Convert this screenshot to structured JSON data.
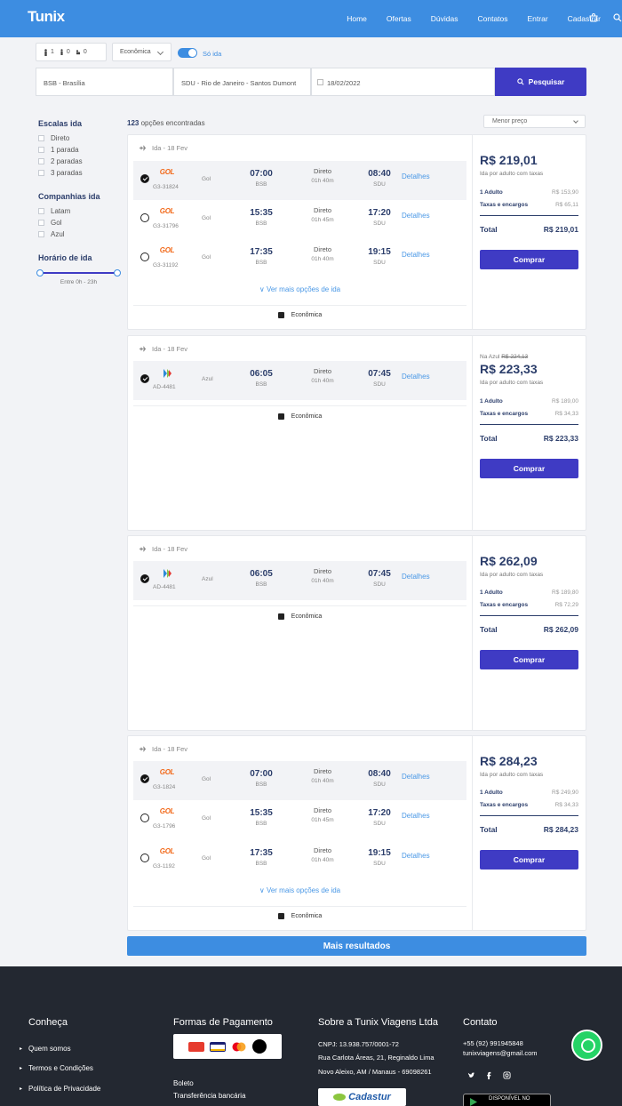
{
  "header": {
    "logo": "Tunix",
    "nav": [
      "Home",
      "Ofertas",
      "Dúvidas",
      "Contatos",
      "Entrar",
      "Cadastrar"
    ]
  },
  "search": {
    "adults": "1",
    "children": "0",
    "infants": "0",
    "cabin": "Econômica",
    "one_way_label": "Só ida",
    "origin": "BSB - Brasília",
    "destination": "SDU - Rio de Janeiro - Santos Dumont",
    "date": "18/02/2022",
    "search_button": "Pesquisar"
  },
  "filters": {
    "stops_title": "Escalas ida",
    "stops": [
      "Direto",
      "1 parada",
      "2 paradas",
      "3 paradas"
    ],
    "airlines_title": "Companhias ida",
    "airlines": [
      "Latam",
      "Gol",
      "Azul"
    ],
    "time_title": "Horário de ida",
    "time_range": "Entre 0h - 23h"
  },
  "results": {
    "count": "123",
    "count_suffix": " opções encontradas",
    "sort": "Menor preço",
    "more_results": "Mais resultados"
  },
  "cards": [
    {
      "header": "Ida - 18 Fev",
      "flights": [
        {
          "airline": "Gol",
          "logo": "GOL",
          "code": "G3-31824",
          "dep": "07:00",
          "dep_apt": "BSB",
          "stops": "Direto",
          "dur": "01h 40m",
          "arr": "08:40",
          "arr_apt": "SDU",
          "details": "Detalhes"
        },
        {
          "airline": "Gol",
          "logo": "GOL",
          "code": "G3-31796",
          "dep": "15:35",
          "dep_apt": "BSB",
          "stops": "Direto",
          "dur": "01h 45m",
          "arr": "17:20",
          "arr_apt": "SDU",
          "details": "Detalhes"
        },
        {
          "airline": "Gol",
          "logo": "GOL",
          "code": "G3-31192",
          "dep": "17:35",
          "dep_apt": "BSB",
          "stops": "Direto",
          "dur": "01h 40m",
          "arr": "19:15",
          "arr_apt": "SDU",
          "details": "Detalhes"
        }
      ],
      "more": "Ver mais opções de ida",
      "cabin": "Econômica",
      "price": "R$ 219,01",
      "price_sub": "Ida por adulto com taxas",
      "adult_label": "1 Adulto",
      "adult_value": "R$ 153,90",
      "tax_label": "Taxas e encargos",
      "tax_value": "R$ 65,11",
      "total_label": "Total",
      "total_value": "R$ 219,01",
      "buy": "Comprar"
    },
    {
      "header": "Ida - 18 Fev",
      "flights": [
        {
          "airline": "Azul",
          "logo": "azul",
          "code": "AD-4481",
          "dep": "06:05",
          "dep_apt": "BSB",
          "stops": "Direto",
          "dur": "01h 40m",
          "arr": "07:45",
          "arr_apt": "SDU",
          "details": "Detalhes"
        }
      ],
      "cabin": "Econômica",
      "was_label": "Na Azul ",
      "was_value": "R$ 224,13",
      "price": "R$ 223,33",
      "price_sub": "Ida por adulto com taxas",
      "adult_label": "1 Adulto",
      "adult_value": "R$ 189,00",
      "tax_label": "Taxas e encargos",
      "tax_value": "R$ 34,33",
      "total_label": "Total",
      "total_value": "R$ 223,33",
      "buy": "Comprar"
    },
    {
      "header": "Ida - 18 Fev",
      "flights": [
        {
          "airline": "Azul",
          "logo": "azul",
          "code": "AD-4481",
          "dep": "06:05",
          "dep_apt": "BSB",
          "stops": "Direto",
          "dur": "01h 40m",
          "arr": "07:45",
          "arr_apt": "SDU",
          "details": "Detalhes"
        }
      ],
      "cabin": "Econômica",
      "price": "R$ 262,09",
      "price_sub": "Ida por adulto com taxas",
      "adult_label": "1 Adulto",
      "adult_value": "R$ 189,80",
      "tax_label": "Taxas e encargos",
      "tax_value": "R$ 72,29",
      "total_label": "Total",
      "total_value": "R$ 262,09",
      "buy": "Comprar"
    },
    {
      "header": "Ida - 18 Fev",
      "flights": [
        {
          "airline": "Gol",
          "logo": "GOL",
          "code": "G3-1824",
          "dep": "07:00",
          "dep_apt": "BSB",
          "stops": "Direto",
          "dur": "01h 40m",
          "arr": "08:40",
          "arr_apt": "SDU",
          "details": "Detalhes"
        },
        {
          "airline": "Gol",
          "logo": "GOL",
          "code": "G3-1796",
          "dep": "15:35",
          "dep_apt": "BSB",
          "stops": "Direto",
          "dur": "01h 45m",
          "arr": "17:20",
          "arr_apt": "SDU",
          "details": "Detalhes"
        },
        {
          "airline": "Gol",
          "logo": "GOL",
          "code": "G3-1192",
          "dep": "17:35",
          "dep_apt": "BSB",
          "stops": "Direto",
          "dur": "01h 40m",
          "arr": "19:15",
          "arr_apt": "SDU",
          "details": "Detalhes"
        }
      ],
      "more": "Ver mais opções de ida",
      "cabin": "Econômica",
      "price": "R$ 284,23",
      "price_sub": "Ida por adulto com taxas",
      "adult_label": "1 Adulto",
      "adult_value": "R$ 249,90",
      "tax_label": "Taxas e encargos",
      "tax_value": "R$ 34,33",
      "total_label": "Total",
      "total_value": "R$ 284,23",
      "buy": "Comprar"
    }
  ],
  "footer": {
    "col1_title": "Conheça",
    "col1_links": [
      "Quem somos",
      "Termos e Condições",
      "Política de Privacidade"
    ],
    "col2_title": "Formas de Pagamento",
    "col2_links": [
      "Boleto",
      "Transferência bancária"
    ],
    "col3_title": "Sobre a Tunix Viagens Ltda",
    "cnpj": "CNPJ: 13.938.757/0001-72",
    "address1": "Rua Carlota Áreas, 21, Reginaldo Lima",
    "address2": "Novo Aleixo, AM / Manaus - 69098261",
    "cadastur": "Cadastur",
    "col4_title": "Contato",
    "phone": "+55 (92) 991945848",
    "email": "tunixviagens@gmail.com",
    "store": "DISPONÍVEL NO"
  },
  "colors": {
    "header": "#3d8de1",
    "primary_button": "#3f3bc4",
    "footer": "#232831",
    "gol": "#f26a1b"
  }
}
